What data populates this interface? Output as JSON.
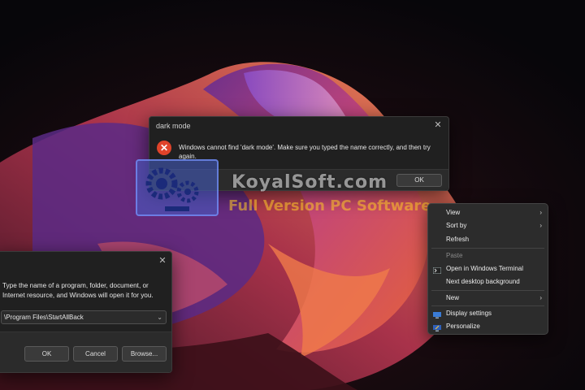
{
  "error_dialog": {
    "title": "dark mode",
    "message": "Windows cannot find 'dark mode'. Make sure you typed the name correctly, and then try again.",
    "ok_label": "OK"
  },
  "watermark": {
    "title": "KoyalSoft.com",
    "subtitle": "Full Version PC Software"
  },
  "run_dialog": {
    "description": "Type the name of a program, folder, document, or Internet resource, and Windows will open it for you.",
    "input_value": "\\Program Files\\StartAllBack",
    "ok_label": "OK",
    "cancel_label": "Cancel",
    "browse_label": "Browse..."
  },
  "context_menu": {
    "items": [
      {
        "label": "View",
        "submenu": true
      },
      {
        "label": "Sort by",
        "submenu": true
      },
      {
        "label": "Refresh"
      },
      {
        "label": "Paste",
        "disabled": true
      },
      {
        "label": "Open in Windows Terminal",
        "icon": "terminal-icon"
      },
      {
        "label": "Next desktop background"
      },
      {
        "label": "New",
        "submenu": true
      },
      {
        "label": "Display settings",
        "icon": "display-icon"
      },
      {
        "label": "Personalize",
        "icon": "personalize-icon"
      }
    ],
    "submenu_glyph": "›"
  },
  "icons": {
    "close_glyph": "✕",
    "error_glyph": "✕",
    "dropdown_glyph": "⌄"
  },
  "colors": {
    "error_icon": "#e0432a",
    "dialog_bg": "#202020",
    "menu_bg": "#2c2c2c"
  }
}
